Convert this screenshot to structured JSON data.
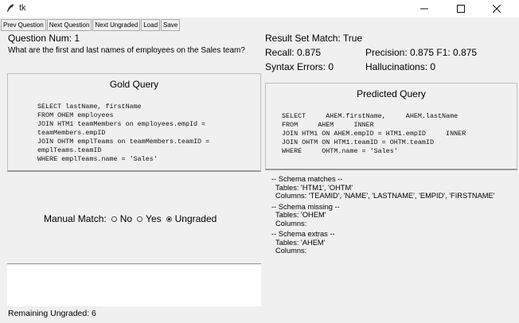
{
  "window": {
    "title": "tk"
  },
  "toolbar": {
    "prev": "Prev Question",
    "next": "Next Question",
    "next_ungraded": "Next Ungraded",
    "load": "Load",
    "save": "Save"
  },
  "question": {
    "num_text": "Question Num: 1",
    "text": "What are the first and last names of employees on the Sales team?"
  },
  "gold": {
    "title": "Gold Query",
    "sql": "SELECT lastName, firstName\nFROM OHEM employees\nJOIN HTM1 teamMembers on employees.empId =\nteamMembers.empID\nJOIN OHTM emplTeams on teamMembers.teamID =\nemplTeams.teamID\nWHERE emplTeams.name = 'Sales'"
  },
  "manual": {
    "label": "Manual Match:",
    "options": [
      {
        "label": "No",
        "selected": false
      },
      {
        "label": "Yes",
        "selected": false
      },
      {
        "label": "Ungraded",
        "selected": true
      }
    ]
  },
  "status": {
    "remaining": "Remaining Ungraded: 6"
  },
  "metrics": {
    "result_match": "Result Set Match: True",
    "recall": "Recall: 0.875",
    "precision_f1": "Precision: 0.875 F1: 0.875",
    "syntax_errors": "Syntax Errors: 0",
    "hallucinations": "Hallucinations: 0"
  },
  "predicted": {
    "title": "Predicted Query",
    "sql": "SELECT     AHEM.firstName,     AHEM.lastName\nFROM     AHEM     INNER\nJOIN HTM1 ON AHEM.empID = HTM1.empID     INNER\nJOIN OHTM ON HTM1.teamID = OHTM.teamID\nWHERE     OHTM.name = 'Sales'"
  },
  "schema": {
    "matches_header": "-- Schema matches --",
    "matches_tables": "Tables: 'HTM1', 'OHTM'",
    "matches_columns": "Columns: 'TEAMID', 'NAME', 'LASTNAME', 'EMPID', 'FIRSTNAME'",
    "missing_header": "-- Schema missing --",
    "missing_tables": "Tables: 'OHEM'",
    "missing_columns": "Columns:",
    "extras_header": "-- Schema extras --",
    "extras_tables": "Tables: 'AHEM'",
    "extras_columns": "Columns:"
  }
}
